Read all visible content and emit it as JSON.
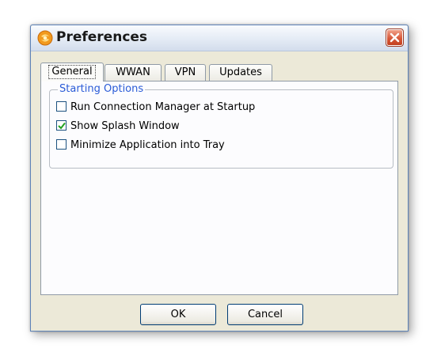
{
  "window": {
    "title": "Preferences",
    "app_icon": "app-logo-icon",
    "close_icon": "close-icon"
  },
  "tabs": [
    {
      "label": "General",
      "active": true
    },
    {
      "label": "WWAN",
      "active": false
    },
    {
      "label": "VPN",
      "active": false
    },
    {
      "label": "Updates",
      "active": false
    }
  ],
  "general": {
    "group_label": "Starting Options",
    "options": [
      {
        "label": "Run Connection Manager at Startup",
        "checked": false
      },
      {
        "label": "Show Splash Window",
        "checked": true
      },
      {
        "label": "Minimize Application into Tray",
        "checked": false
      }
    ]
  },
  "buttons": {
    "ok": "OK",
    "cancel": "Cancel"
  },
  "colors": {
    "accent": "#2a5bd7",
    "close": "#d8593a",
    "dialog_bg": "#ece9d8",
    "check": "#21a121"
  }
}
